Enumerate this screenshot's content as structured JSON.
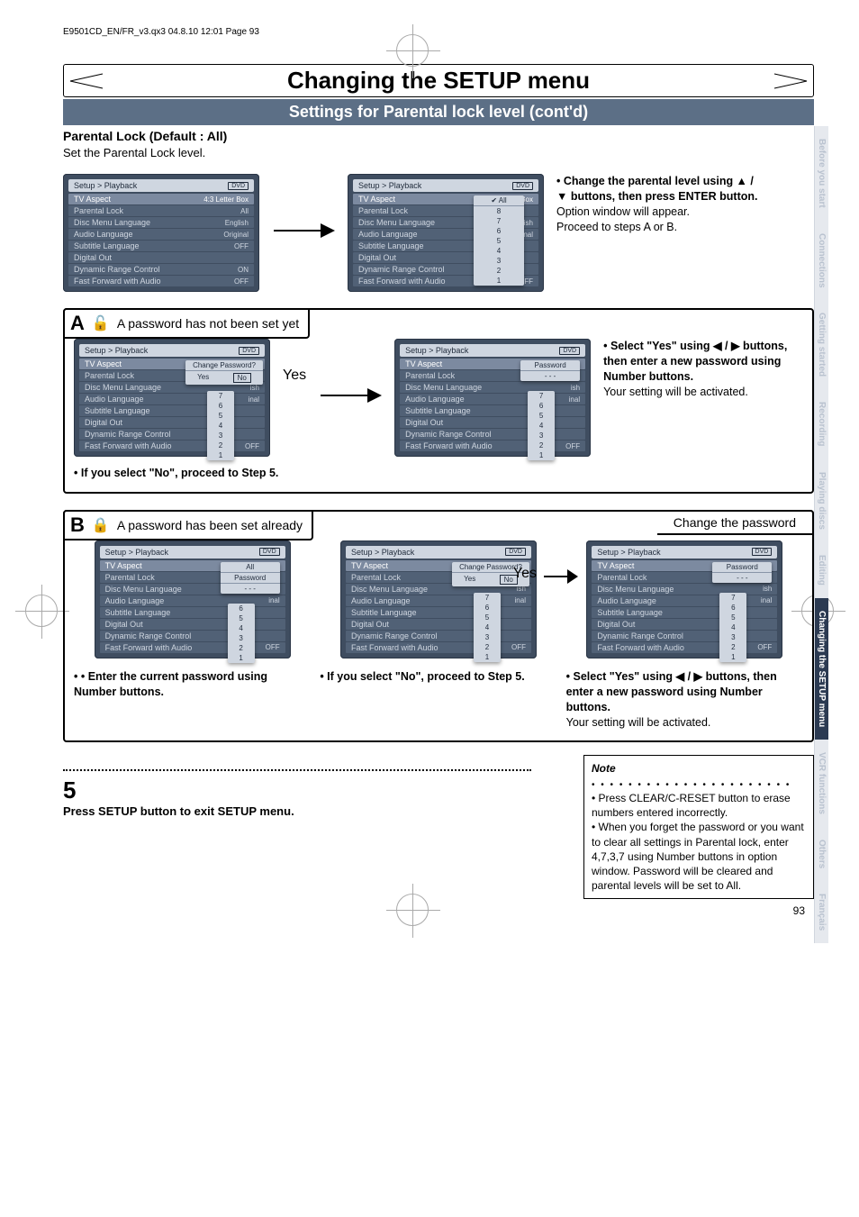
{
  "header_line": "E9501CD_EN/FR_v3.qx3  04.8.10  12:01  Page 93",
  "title": "Changing the SETUP menu",
  "subtitle": "Settings for Parental lock level (cont'd)",
  "section_head": "Parental Lock (Default : All)",
  "section_sub": "Set the Parental Lock level.",
  "side_tabs": [
    "Before you start",
    "Connections",
    "Getting started",
    "Recording",
    "Playing discs",
    "Editing",
    "Changing the SETUP menu",
    "VCR functions",
    "Others",
    "Français"
  ],
  "active_tab_index": 6,
  "osd_breadcrumb": "Setup > Playback",
  "osd_badge": "DVD",
  "osd_items": [
    {
      "label": "TV Aspect",
      "val": "4:3 Letter Box"
    },
    {
      "label": "Parental Lock",
      "val": "All"
    },
    {
      "label": "Disc Menu Language",
      "val": "English"
    },
    {
      "label": "Audio Language",
      "val": "Original"
    },
    {
      "label": "Subtitle Language",
      "val": "OFF"
    },
    {
      "label": "Digital Out",
      "val": ""
    },
    {
      "label": "Dynamic Range Control",
      "val": "ON"
    },
    {
      "label": "Fast Forward with Audio",
      "val": "OFF"
    }
  ],
  "popup_levels_header": "All",
  "popup_levels": [
    "8",
    "7",
    "6",
    "5",
    "4",
    "3",
    "2",
    "1"
  ],
  "top_instr_1": "• Change the parental level using ▲ / ▼ buttons, then press ENTER button.",
  "top_instr_2": "Option window will appear.",
  "top_instr_3": "Proceed to steps A or B.",
  "blockA_label": "A password has not been set yet",
  "yes_label": "Yes",
  "change_pw_popup_title": "Change Password?",
  "change_pw_yes": "Yes",
  "change_pw_no": "No",
  "password_popup_title": "Password",
  "password_mask": "- - -",
  "a_instr_1": "• Select \"Yes\" using ◀ / ▶ buttons, then enter a new password using Number buttons.",
  "a_instr_2": "Your setting will be activated.",
  "a_note": "• If you select \"No\", proceed to Step 5.",
  "blockB_label": "A password has been set already",
  "change_pw_box": "Change the password",
  "b_col1": "• Enter the current password using Number buttons.",
  "b_col2": "• If you select \"No\", proceed to Step 5.",
  "b_col3_1": "• Select \"Yes\" using ◀ / ▶ buttons, then enter a new password using Number buttons.",
  "b_col3_2": "Your setting will be activated.",
  "note_title": "Note",
  "note_1": "• Press CLEAR/C-RESET button to erase numbers entered incorrectly.",
  "note_2": "• When you forget the password or you want to clear all settings in Parental lock, enter 4,7,3,7 using Number buttons in option window. Password will be cleared and parental levels will be set to All.",
  "step5_num": "5",
  "step5_txt": "Press SETUP button to exit SETUP menu.",
  "page_num": "93"
}
